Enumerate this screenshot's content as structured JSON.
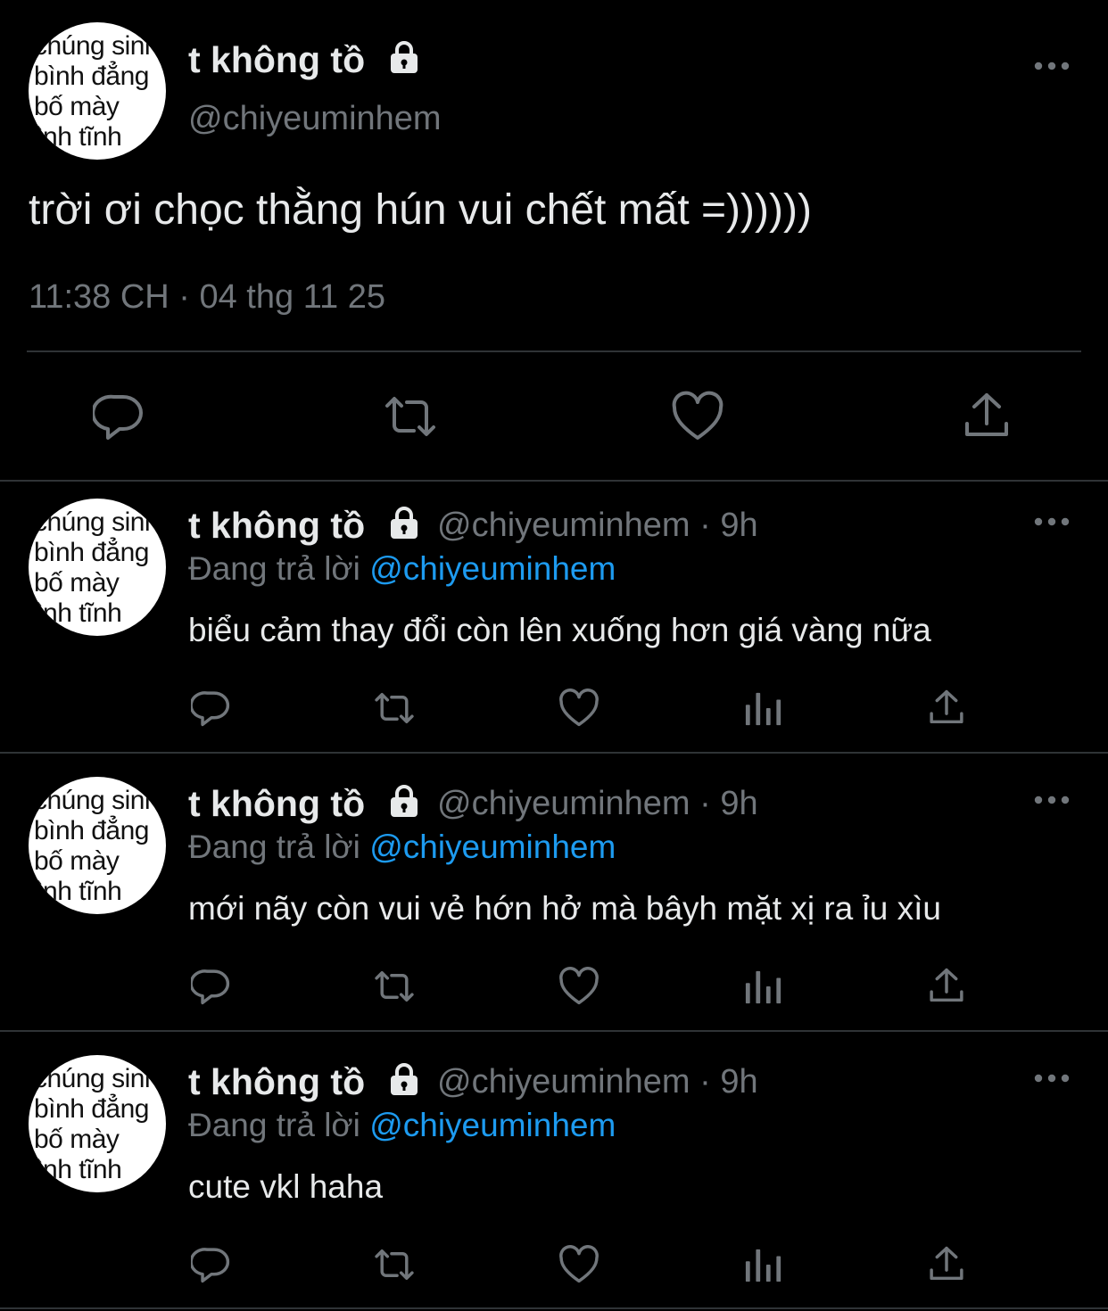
{
  "main_tweet": {
    "author_name": "t không tồ",
    "handle": "@chiyeuminhem",
    "text": "trời ơi chọc thằng hún vui chết mất =))))))",
    "timestamp": "11:38 CH · 04 thg 11 25",
    "avatar_lines": [
      "chúng sinh",
      "bình đẳng",
      "bố      mày",
      "bình   tĩnh"
    ]
  },
  "replies": [
    {
      "author_name": "t không tồ",
      "handle_time": "@chiyeuminhem · 9h",
      "replying_label": "Đang trả lời",
      "replying_to": "@chiyeuminhem",
      "text": "biểu cảm thay đổi còn lên xuống hơn giá vàng nữa"
    },
    {
      "author_name": "t không tồ",
      "handle_time": "@chiyeuminhem · 9h",
      "replying_label": "Đang trả lời",
      "replying_to": "@chiyeuminhem",
      "text": "mới nãy còn vui vẻ hớn hở mà bâyh mặt xị ra ỉu xìu"
    },
    {
      "author_name": "t không tồ",
      "handle_time": "@chiyeuminhem · 9h",
      "replying_label": "Đang trả lời",
      "replying_to": "@chiyeuminhem",
      "text": "cute vkl haha"
    }
  ],
  "icons": {
    "reply": "reply-icon",
    "retweet": "retweet-icon",
    "like": "like-icon",
    "views": "views-icon",
    "share": "share-icon",
    "more": "more-icon",
    "lock": "lock-icon"
  },
  "colors": {
    "background": "#000000",
    "text": "#e7e9ea",
    "secondary": "#71767b",
    "accent": "#1d9bf0",
    "divider": "#2f3336"
  }
}
